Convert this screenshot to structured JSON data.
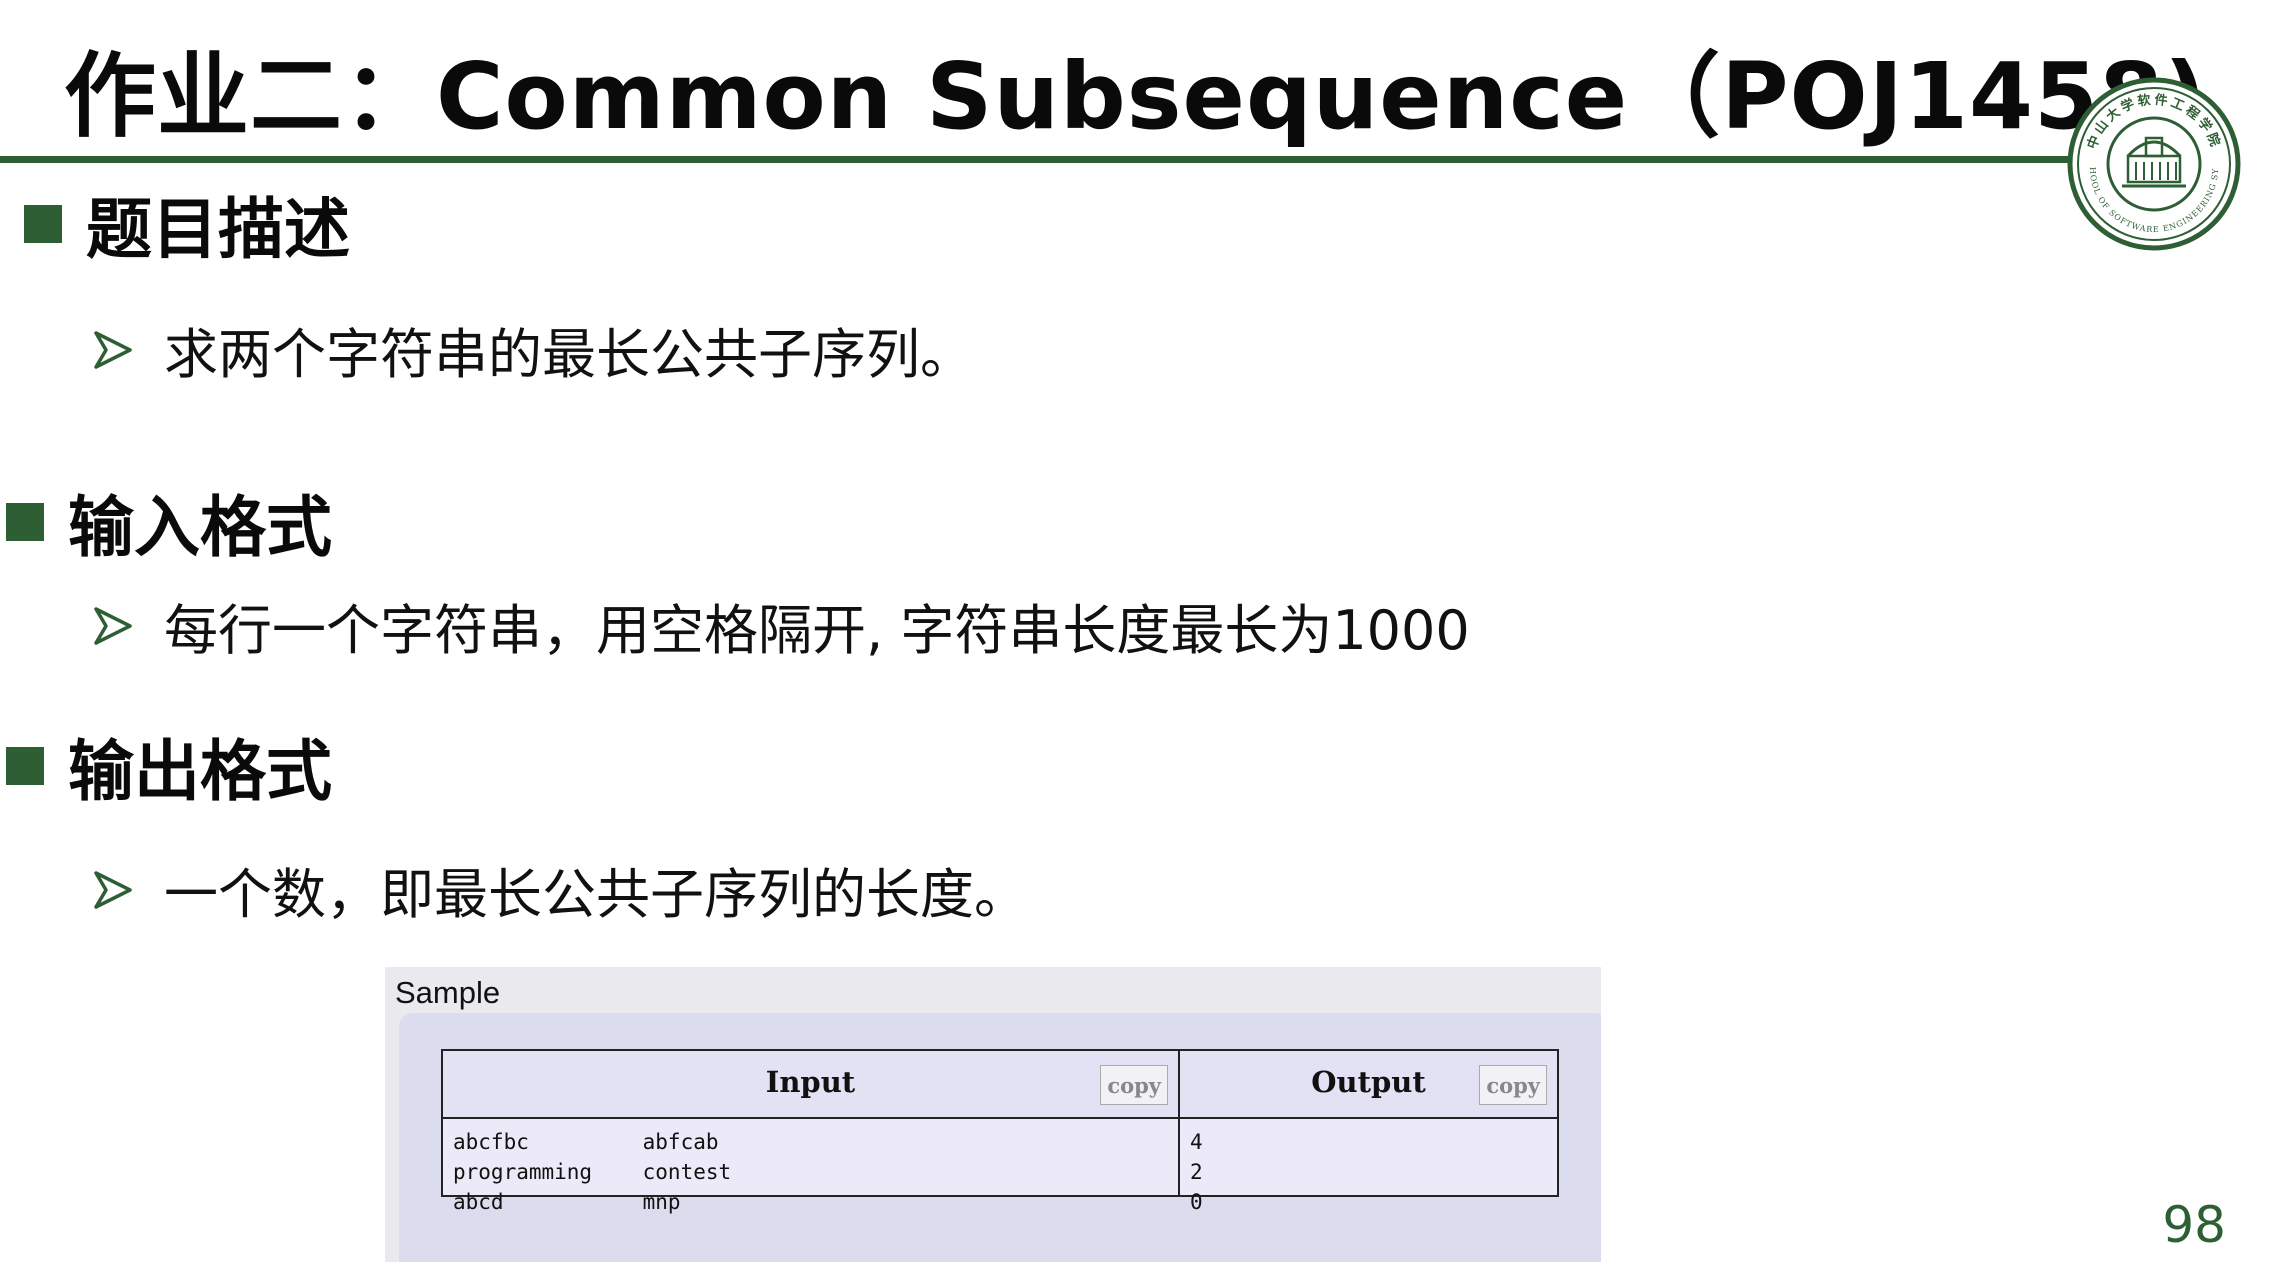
{
  "slide": {
    "title": "作业二：Common Subsequence（POJ1458)",
    "page_number": "98",
    "accent_color": "#2e5e34"
  },
  "sections": [
    {
      "heading": "题目描述",
      "bullet": "求两个字符串的最长公共子序列。"
    },
    {
      "heading": "输入格式",
      "bullet": "每行一个字符串，用空格隔开, 字符串长度最长为1000"
    },
    {
      "heading": "输出格式",
      "bullet": "一个数，即最长公共子序列的长度。"
    }
  ],
  "sample": {
    "label": "Sample",
    "input_header": "Input",
    "output_header": "Output",
    "copy_label": "copy",
    "input_rows": [
      "abcfbc         abfcab",
      "programming    contest",
      "abcd           mnp"
    ],
    "output_rows": [
      "4",
      "2",
      "0"
    ]
  },
  "logo": {
    "name": "school-of-software-engineering-seal",
    "text_top": "中山大学软件工程学院",
    "text_bottom": "SCHOOL OF SOFTWARE ENGINEERING SYSU"
  }
}
